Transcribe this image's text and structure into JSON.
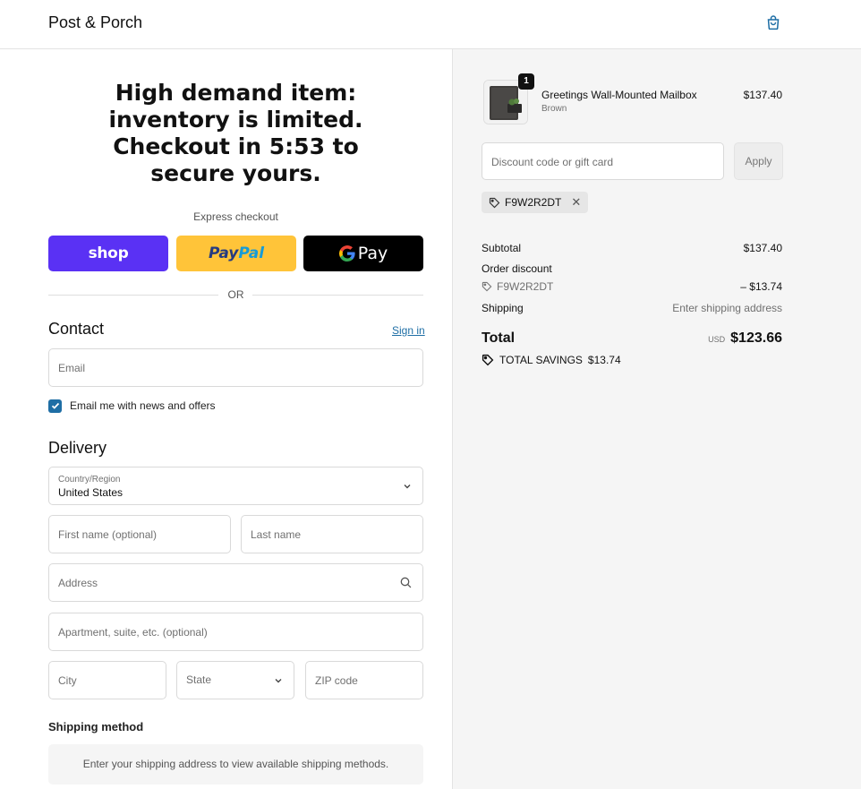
{
  "header": {
    "brand": "Post & Porch",
    "cart_icon": "shopping-bag-icon",
    "accent_color": "#1e6ea5"
  },
  "banner": {
    "line1": "High demand item:",
    "line2": "inventory is limited.",
    "line3": "Checkout in 5:53 to",
    "line4": "secure yours."
  },
  "express": {
    "label": "Express checkout",
    "shop_label": "shop",
    "paypal_part1": "Pay",
    "paypal_part2": "Pal",
    "gpay_g": "G",
    "gpay_label": "Pay",
    "or_label": "OR"
  },
  "contact": {
    "title": "Contact",
    "sign_in": "Sign in",
    "email_placeholder": "Email",
    "newsletter_label": "Email me with news and offers",
    "newsletter_checked": true
  },
  "delivery": {
    "title": "Delivery",
    "country_label": "Country/Region",
    "country_value": "United States",
    "first_name_placeholder": "First name (optional)",
    "last_name_placeholder": "Last name",
    "address_placeholder": "Address",
    "apartment_placeholder": "Apartment, suite, etc. (optional)",
    "city_placeholder": "City",
    "state_placeholder": "State",
    "zip_placeholder": "ZIP code"
  },
  "shipping": {
    "title": "Shipping method",
    "message": "Enter your shipping address to view available shipping methods."
  },
  "summary": {
    "product": {
      "name": "Greetings Wall-Mounted Mailbox",
      "variant": "Brown",
      "price": "$137.40",
      "quantity": "1"
    },
    "discount_placeholder": "Discount code or gift card",
    "apply_label": "Apply",
    "applied_code": "F9W2R2DT",
    "subtotal_label": "Subtotal",
    "subtotal_value": "$137.40",
    "order_discount_label": "Order discount",
    "discount_code": "F9W2R2DT",
    "discount_value": "– $13.74",
    "shipping_label": "Shipping",
    "shipping_value": "Enter shipping address",
    "total_label": "Total",
    "currency": "USD",
    "total_value": "$123.66",
    "savings_label": "TOTAL SAVINGS",
    "savings_value": "$13.74"
  }
}
